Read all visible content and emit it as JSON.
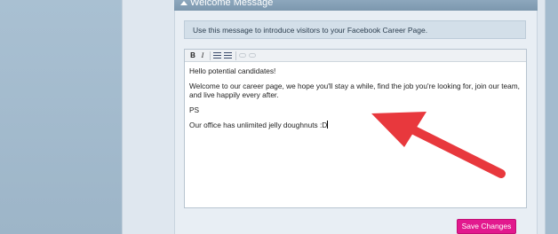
{
  "panel": {
    "title": "Welcome Message",
    "info_text": "Use this message to introduce visitors to your Facebook Career Page."
  },
  "toolbar": {
    "bold_label": "B",
    "italic_label": "I",
    "icons": [
      "bullet-list-icon",
      "numbered-list-icon",
      "link-icon",
      "unlink-icon"
    ]
  },
  "editor": {
    "paragraphs": [
      "Hello potential candidates!",
      "Welcome to our career page, we hope you'll stay a while, find the job you're looking for, join our team, and live happily every after.",
      "PS",
      "Our office has unlimited jelly doughnuts :D"
    ]
  },
  "actions": {
    "save_label": "Save Changes"
  },
  "colors": {
    "accent": "#e2198e",
    "header": "#8da7bd",
    "annotation_arrow": "#e8383d"
  }
}
